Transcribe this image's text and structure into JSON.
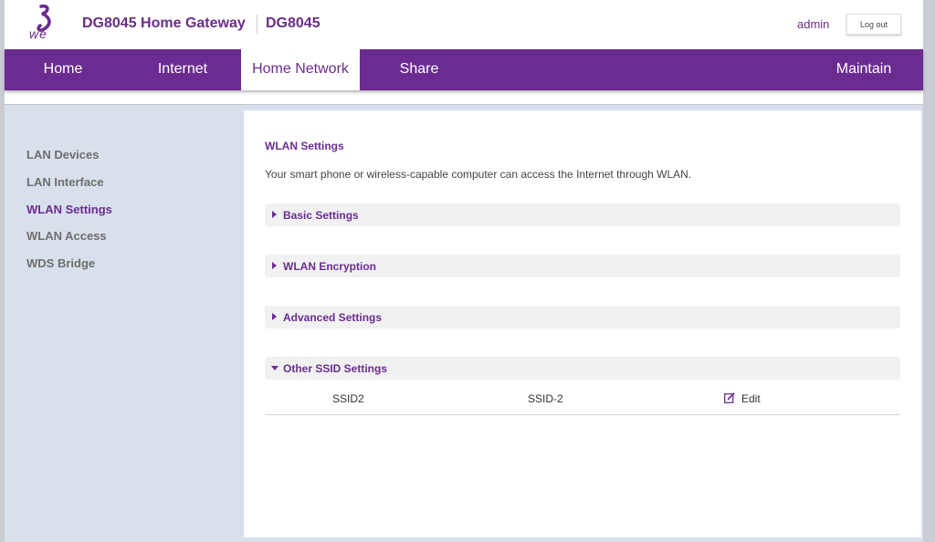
{
  "header": {
    "brand_logo": "we",
    "product_title": "DG8045 Home Gateway",
    "model": "DG8045",
    "user": "admin",
    "logout_label": "Log out"
  },
  "nav": {
    "items": [
      "Home",
      "Internet",
      "Home Network",
      "Share",
      "Maintain"
    ],
    "active": "Home Network"
  },
  "sidebar": {
    "items": [
      "LAN Devices",
      "LAN Interface",
      "WLAN Settings",
      "WLAN Access",
      "WDS Bridge"
    ],
    "active": "WLAN Settings"
  },
  "content": {
    "title": "WLAN Settings",
    "description": "Your smart phone or wireless-capable computer can access the Internet through WLAN.",
    "sections": [
      {
        "label": "Basic Settings",
        "expanded": false
      },
      {
        "label": "WLAN Encryption",
        "expanded": false
      },
      {
        "label": "Advanced Settings",
        "expanded": false
      },
      {
        "label": "Other SSID Settings",
        "expanded": true
      }
    ],
    "ssid_rows": [
      {
        "name": "SSID2",
        "ssid": "SSID-2",
        "action": "Edit"
      }
    ]
  },
  "colors": {
    "brand_purple": "#6b2c91",
    "sidebar_bg": "#d8e0eb",
    "section_bg": "#f1f1f1"
  },
  "icons": {
    "logo": "we-logo",
    "section_collapsed": "triangle-right-icon",
    "section_expanded": "triangle-down-icon",
    "edit": "edit-icon"
  }
}
